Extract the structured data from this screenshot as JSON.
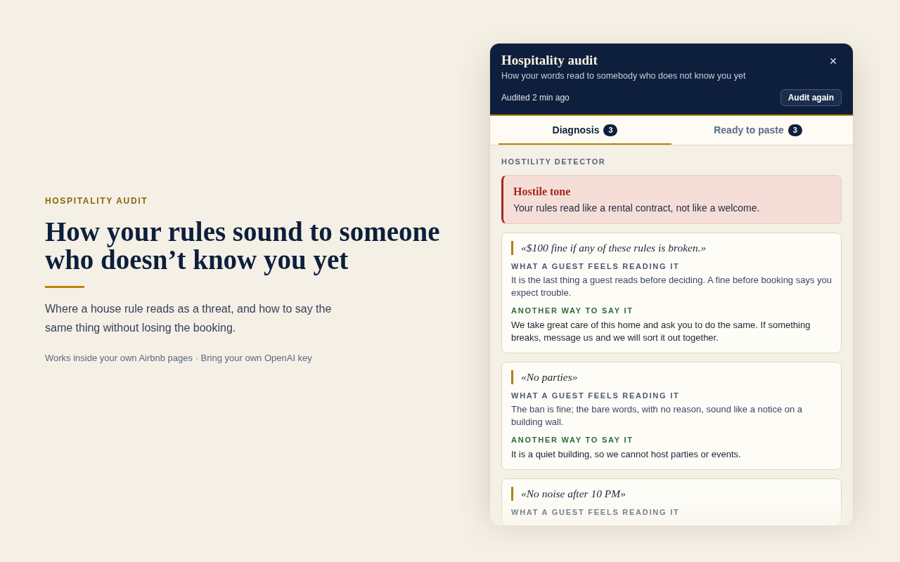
{
  "intro": {
    "eyebrow": "HOSPITALITY AUDIT",
    "title": "How your rules sound to someone who doesn’t know you yet",
    "lead": "Where a house rule reads as a threat, and how to say the same thing without losing the booking.",
    "footnote": "Works inside your own Airbnb pages · Bring your own OpenAI key"
  },
  "panel": {
    "title": "Hospitality audit",
    "subtitle": "How your words read to somebody who does not know you yet",
    "close": "×",
    "status": "Audited 2 min ago",
    "action": "Audit again",
    "tabs": [
      {
        "label": "Diagnosis",
        "count": "3",
        "selected": true
      },
      {
        "label": "Ready to paste",
        "count": "3",
        "selected": false
      }
    ],
    "section_label": "HOSTILITY DETECTOR",
    "alert": {
      "title": "Hostile tone",
      "message": "Your rules read like a rental contract, not like a welcome."
    },
    "findings": [
      {
        "quote": "«$100 fine if any of these rules is broken.»",
        "feeling_label": "WHAT A GUEST FEELS READING IT",
        "feeling": "It is the last thing a guest reads before deciding. A fine before booking says you expect trouble.",
        "rewrite_label": "ANOTHER WAY TO SAY IT",
        "rewrite": "We take great care of this home and ask you to do the same. If something breaks, message us and we will sort it out together."
      },
      {
        "quote": "«No parties»",
        "feeling_label": "WHAT A GUEST FEELS READING IT",
        "feeling": "The ban is fine; the bare words, with no reason, sound like a notice on a building wall.",
        "rewrite_label": "ANOTHER WAY TO SAY IT",
        "rewrite": "It is a quiet building, so we cannot host parties or events."
      },
      {
        "quote": "«No noise after 10 PM»",
        "feeling_label": "WHAT A GUEST FEELS READING IT"
      }
    ]
  }
}
